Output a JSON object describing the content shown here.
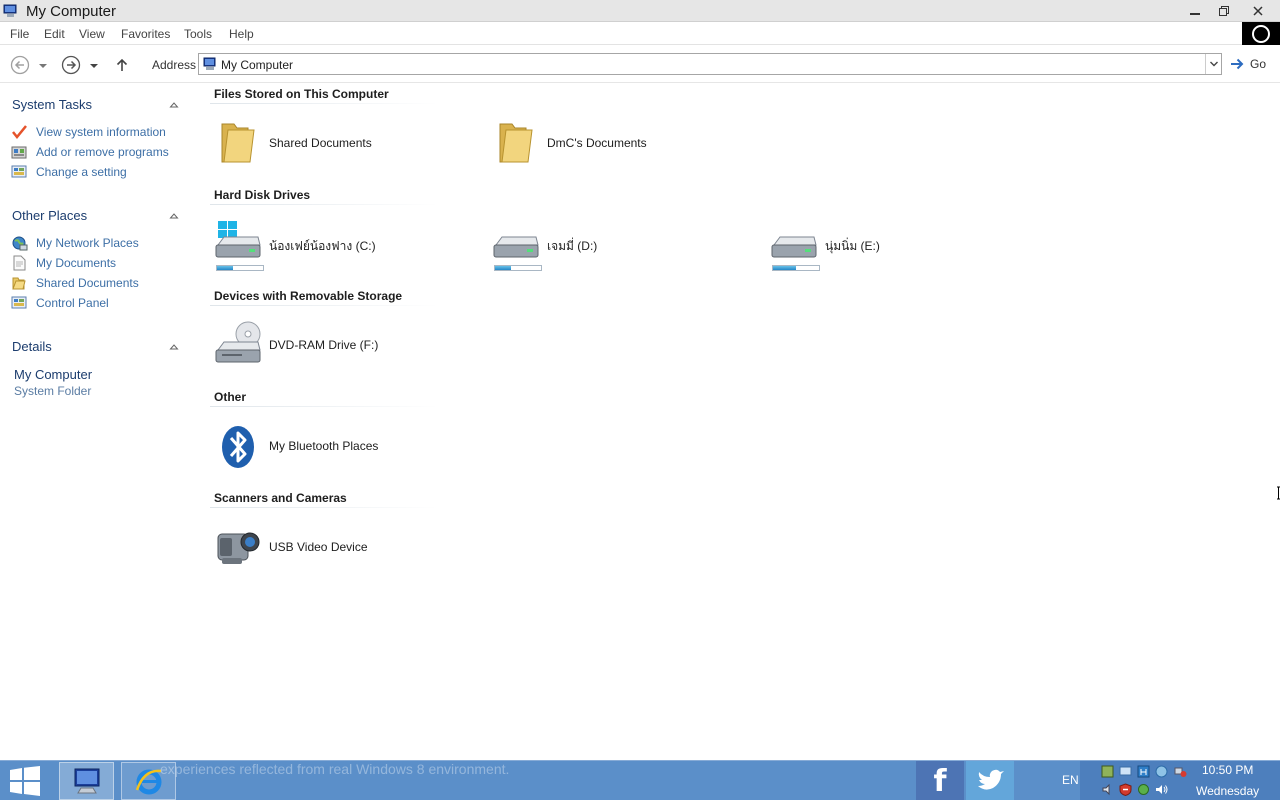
{
  "window": {
    "title": "My Computer"
  },
  "menu": [
    "File",
    "Edit",
    "View",
    "Favorites",
    "Tools",
    "Help"
  ],
  "toolbar": {
    "address_label": "Address",
    "address_value": "My Computer",
    "go_label": "Go"
  },
  "left_pane": {
    "system_tasks": {
      "title": "System Tasks",
      "items": [
        "View system information",
        "Add or remove programs",
        "Change a setting"
      ]
    },
    "other_places": {
      "title": "Other Places",
      "items": [
        "My Network Places",
        "My Documents",
        "Shared Documents",
        "Control Panel"
      ]
    },
    "details": {
      "title": "Details",
      "name": "My Computer",
      "type": "System Folder"
    }
  },
  "groups": {
    "files": {
      "title": "Files Stored on This Computer",
      "items": [
        "Shared Documents",
        "DmC's Documents"
      ]
    },
    "hard_disks": {
      "title": "Hard Disk Drives",
      "items": [
        {
          "label": "น้องเฟย์น้องฟาง (C:)",
          "usage": 0.35
        },
        {
          "label": "เจมมี่ (D:)",
          "usage": 0.35
        },
        {
          "label": "นุ่มนิ่ม (E:)",
          "usage": 0.5
        }
      ]
    },
    "removable": {
      "title": "Devices with Removable Storage",
      "items": [
        "DVD-RAM Drive (F:)"
      ]
    },
    "other": {
      "title": "Other",
      "items": [
        "My Bluetooth Places"
      ]
    },
    "scanners": {
      "title": "Scanners and Cameras",
      "items": [
        "USB Video Device"
      ]
    }
  },
  "taskbar": {
    "marquee": "experiences reflected from real Windows 8 environment.",
    "language": "EN",
    "facebook": "f",
    "time": "10:50 PM",
    "day": "Wednesday"
  },
  "colors": {
    "taskbar": "#5b8fc9",
    "link": "#3d6fa6",
    "section_header": "#1c3d6e",
    "usage_fill": "#2586c7"
  }
}
